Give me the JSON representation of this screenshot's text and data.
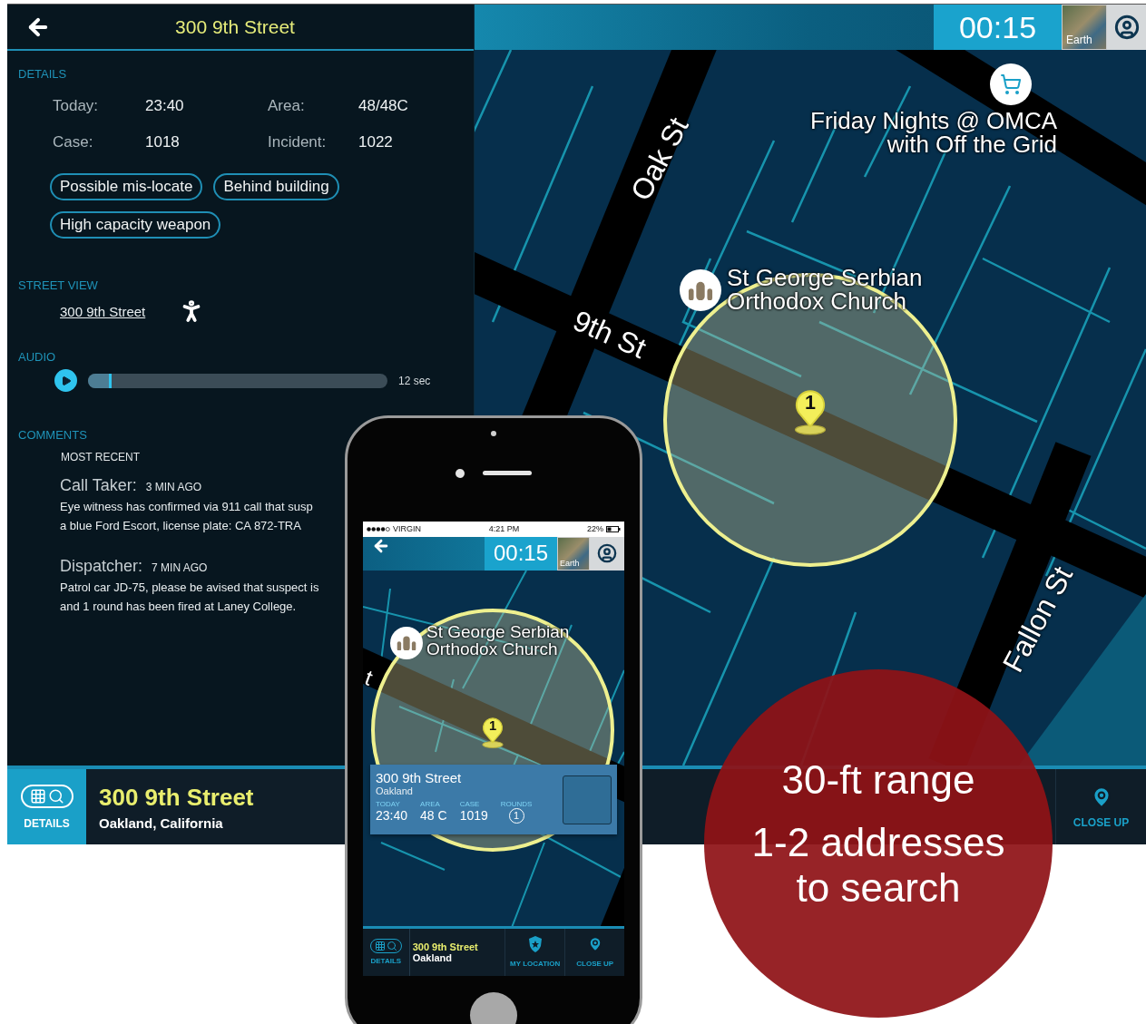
{
  "tablet": {
    "details_panel": {
      "title": "300 9th Street",
      "details_heading": "DETAILS",
      "fields": [
        {
          "label": "Today:",
          "value": "23:40"
        },
        {
          "label": "Area:",
          "value": "48/48C"
        },
        {
          "label": "Case:",
          "value": "1018"
        },
        {
          "label": "Incident:",
          "value": "1022"
        }
      ],
      "tags": [
        "Possible mis-locate",
        "Behind building",
        "High capacity weapon"
      ],
      "street_view": {
        "heading": "STREET VIEW",
        "link": "300 9th Street"
      },
      "audio": {
        "heading": "AUDIO",
        "level": 0.07,
        "duration": "12 sec"
      },
      "comments": {
        "heading": "COMMENTS",
        "subheading": "MOST RECENT",
        "items": [
          {
            "author": "Call Taker:",
            "time": "3 MIN AGO",
            "text": "Eye witness has confirmed via 911 call that susp\na blue Ford Escort, license plate: CA 872-TRA"
          },
          {
            "author": "Dispatcher:",
            "time": "7 MIN AGO",
            "text": "Patrol car JD-75, please be avised that suspect is\nand 1 round has been fired at Laney College."
          }
        ]
      }
    },
    "top_bar": {
      "timer": "00:15",
      "map_type": "Earth"
    },
    "map": {
      "streets": [
        {
          "name": "Oak St",
          "kind": "oak"
        },
        {
          "name": "9th St",
          "kind": "ninth"
        },
        {
          "name": "Fallon St",
          "kind": "fallon"
        }
      ],
      "places": [
        {
          "name": "Friday Nights @ OMCA\nwith Off the Grid",
          "kind": "shop"
        },
        {
          "name": "St George Serbian\nOrthodox Church",
          "kind": "church"
        }
      ],
      "pin": "1"
    },
    "bottom_bar": {
      "details_label": "DETAILS",
      "address": "300 9th Street",
      "city": "Oakland, California",
      "actions": [
        {
          "label": "CLOSE UP",
          "kind": "close-up"
        }
      ]
    }
  },
  "phone": {
    "status_bar": {
      "carrier": "VIRGIN",
      "time": "4:21 PM",
      "battery": "22%"
    },
    "top_bar": {
      "timer": "00:15",
      "map_type": "Earth"
    },
    "map": {
      "street_fragment": "t",
      "place": "St George Serbian\nOrthodox Church",
      "pin": "1"
    },
    "info_card": {
      "address": "300 9th Street",
      "city": "Oakland",
      "stats": [
        {
          "label": "TODAY",
          "value": "23:40",
          "kind": "text"
        },
        {
          "label": "AREA",
          "value": "48 C",
          "kind": "text"
        },
        {
          "label": "CASE",
          "value": "1019",
          "kind": "text"
        },
        {
          "label": "ROUNDS",
          "value": "1",
          "kind": "circled"
        }
      ]
    },
    "bottom_bar": {
      "details_label": "DETAILS",
      "address": "300 9th Street",
      "city": "Oakland",
      "actions": [
        {
          "label": "MY LOCATION",
          "kind": "my-location"
        },
        {
          "label": "CLOSE UP",
          "kind": "close-up"
        }
      ]
    }
  },
  "callout": {
    "lines": [
      "30-ft range",
      "1-2 addresses\nto search"
    ]
  }
}
